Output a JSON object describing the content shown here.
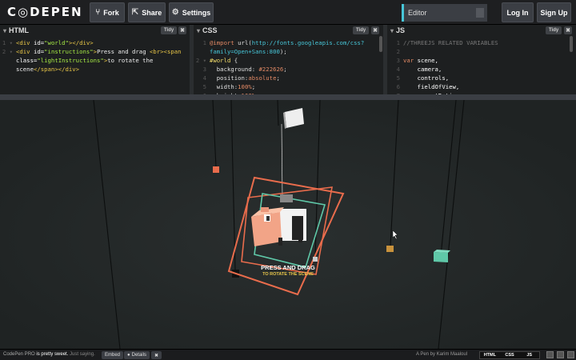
{
  "header": {
    "logo": "C◎DEPEN",
    "fork": "Fork",
    "share": "Share",
    "settings": "Settings",
    "editor": "Editor",
    "login": "Log In",
    "signup": "Sign Up"
  },
  "html_pane": {
    "title": "HTML",
    "tidy": "Tidy",
    "close": "✖",
    "lines": [
      {
        "n": "1",
        "chev": "▾",
        "parts": [
          [
            "c-tag",
            "<div "
          ],
          [
            "c-attr",
            "id="
          ],
          [
            "c-str",
            "\"world\""
          ],
          [
            "c-tag",
            "></div>"
          ]
        ]
      },
      {
        "n": "2",
        "chev": "▾",
        "parts": [
          [
            "c-tag",
            "<div "
          ],
          [
            "c-attr",
            "id="
          ],
          [
            "c-str",
            "\"instructions\""
          ],
          [
            "c-tag",
            ">"
          ],
          [
            "c-txt",
            "Press and drag "
          ],
          [
            "c-tag",
            "<br><span"
          ]
        ]
      },
      {
        "n": "",
        "chev": "",
        "parts": [
          [
            "c-attr",
            "class="
          ],
          [
            "c-str",
            "\"lightInstructions\""
          ],
          [
            "c-tag",
            ">"
          ],
          [
            "c-txt",
            "to rotate the"
          ]
        ]
      },
      {
        "n": "",
        "chev": "",
        "parts": [
          [
            "c-txt",
            "scene"
          ],
          [
            "c-tag",
            "</span></div>"
          ]
        ]
      }
    ]
  },
  "css_pane": {
    "title": "CSS",
    "tidy": "Tidy",
    "close": "✖",
    "lines": [
      {
        "n": "1",
        "chev": "",
        "parts": [
          [
            "c-kw",
            "@import "
          ],
          [
            "c-prop",
            "url("
          ],
          [
            "c-url",
            "http://fonts.googleapis.com/css?"
          ]
        ]
      },
      {
        "n": "",
        "chev": "",
        "parts": [
          [
            "c-url",
            "family=Open+Sans:800"
          ],
          [
            "c-prop",
            ");"
          ]
        ]
      },
      {
        "n": "2",
        "chev": "▾",
        "parts": [
          [
            "c-sel",
            "#world "
          ],
          [
            "c-prop",
            "{"
          ]
        ]
      },
      {
        "n": "3",
        "chev": "",
        "parts": [
          [
            "c-prop",
            "  background: "
          ],
          [
            "c-val",
            "#222626"
          ],
          [
            "c-prop",
            ";"
          ]
        ]
      },
      {
        "n": "4",
        "chev": "",
        "parts": [
          [
            "c-prop",
            "  position:"
          ],
          [
            "c-val",
            "absolute"
          ],
          [
            "c-prop",
            ";"
          ]
        ]
      },
      {
        "n": "5",
        "chev": "",
        "parts": [
          [
            "c-prop",
            "  width:"
          ],
          [
            "c-val",
            "100%"
          ],
          [
            "c-prop",
            ";"
          ]
        ]
      },
      {
        "n": "6",
        "chev": "",
        "parts": [
          [
            "c-prop",
            "  height:"
          ],
          [
            "c-val",
            "100%"
          ],
          [
            "c-prop",
            ";"
          ]
        ]
      }
    ]
  },
  "js_pane": {
    "title": "JS",
    "tidy": "Tidy",
    "close": "✖",
    "lines": [
      {
        "n": "1",
        "chev": "",
        "parts": [
          [
            "c-cm",
            "//THREEJS RELATED VARIABLES"
          ]
        ]
      },
      {
        "n": "2",
        "chev": "",
        "parts": []
      },
      {
        "n": "3",
        "chev": "",
        "parts": [
          [
            "c-kw",
            "var "
          ],
          [
            "c-var",
            "scene,"
          ]
        ]
      },
      {
        "n": "4",
        "chev": "",
        "parts": [
          [
            "c-var",
            "    camera,"
          ]
        ]
      },
      {
        "n": "5",
        "chev": "",
        "parts": [
          [
            "c-var",
            "    controls,"
          ]
        ]
      },
      {
        "n": "6",
        "chev": "",
        "parts": [
          [
            "c-var",
            "    fieldOfView,"
          ]
        ]
      },
      {
        "n": "7",
        "chev": "",
        "parts": [
          [
            "c-var",
            "    aspectRatio,"
          ]
        ]
      }
    ]
  },
  "scene": {
    "instruction_main": "PRESS AND DRAG",
    "instruction_sub": "TO ROTATE THE SCENE"
  },
  "footer": {
    "pro_text_a": "CodePen PRO",
    "pro_text_b": " is pretty sweet.",
    "pro_text_c": " Just saying.",
    "embed": "Embed",
    "details": "Details",
    "close": "✖",
    "credit": "A Pen by Karim Maaloul",
    "view_html": "HTML",
    "view_css": "CSS",
    "view_js": "JS"
  },
  "colors": {
    "accent": "#47c6d8",
    "orange": "#e96c4c",
    "teal": "#5fc8a8"
  }
}
